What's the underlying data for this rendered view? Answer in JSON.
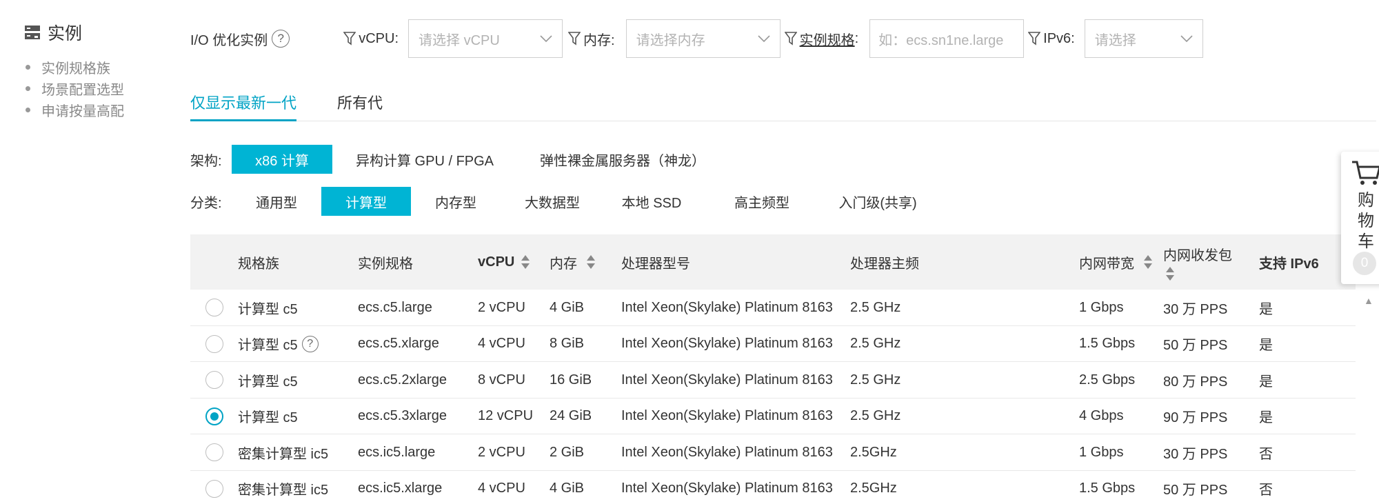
{
  "sidebar": {
    "title": "实例",
    "items": [
      {
        "label": "实例规格族"
      },
      {
        "label": "场景配置选型"
      },
      {
        "label": "申请按量高配"
      }
    ]
  },
  "filters": {
    "io_label": "I/O 优化实例",
    "vcpu_label": "vCPU:",
    "vcpu_placeholder": "请选择 vCPU",
    "memory_label": "内存:",
    "memory_placeholder": "请选择内存",
    "spec_label": "实例规格",
    "spec_colon": ":",
    "spec_placeholder": "如：ecs.sn1ne.large",
    "ipv6_label": "IPv6:",
    "ipv6_placeholder": "请选择"
  },
  "tabs": [
    {
      "label": "仅显示最新一代",
      "active": true
    },
    {
      "label": "所有代",
      "active": false
    }
  ],
  "architecture": {
    "label": "架构:",
    "options": [
      {
        "label": "x86 计算",
        "selected": true
      },
      {
        "label": "异构计算 GPU / FPGA",
        "selected": false
      },
      {
        "label": "弹性裸金属服务器（神龙）",
        "selected": false
      }
    ]
  },
  "category": {
    "label": "分类:",
    "options": [
      {
        "label": "通用型",
        "selected": false
      },
      {
        "label": "计算型",
        "selected": true
      },
      {
        "label": "内存型",
        "selected": false
      },
      {
        "label": "大数据型",
        "selected": false
      },
      {
        "label": "本地 SSD",
        "selected": false
      },
      {
        "label": "高主频型",
        "selected": false
      },
      {
        "label": "入门级(共享)",
        "selected": false
      }
    ]
  },
  "table": {
    "columns": {
      "family": "规格族",
      "spec": "实例规格",
      "vcpu": "vCPU",
      "memory": "内存",
      "processor": "处理器型号",
      "frequency": "处理器主频",
      "bandwidth": "内网带宽",
      "pps": "内网收发包",
      "ipv6": "支持 IPv6"
    },
    "rows": [
      {
        "family": "计算型 c5",
        "spec": "ecs.c5.large",
        "vcpu": "2 vCPU",
        "memory": "4 GiB",
        "processor": "Intel Xeon(Skylake) Platinum 8163",
        "frequency": "2.5 GHz",
        "bandwidth": "1 Gbps",
        "pps": "30 万 PPS",
        "ipv6": "是",
        "selected": false,
        "help": false
      },
      {
        "family": "计算型 c5",
        "spec": "ecs.c5.xlarge",
        "vcpu": "4 vCPU",
        "memory": "8 GiB",
        "processor": "Intel Xeon(Skylake) Platinum 8163",
        "frequency": "2.5 GHz",
        "bandwidth": "1.5 Gbps",
        "pps": "50 万 PPS",
        "ipv6": "是",
        "selected": false,
        "help": true
      },
      {
        "family": "计算型 c5",
        "spec": "ecs.c5.2xlarge",
        "vcpu": "8 vCPU",
        "memory": "16 GiB",
        "processor": "Intel Xeon(Skylake) Platinum 8163",
        "frequency": "2.5 GHz",
        "bandwidth": "2.5 Gbps",
        "pps": "80 万 PPS",
        "ipv6": "是",
        "selected": false,
        "help": false
      },
      {
        "family": "计算型 c5",
        "spec": "ecs.c5.3xlarge",
        "vcpu": "12 vCPU",
        "memory": "24 GiB",
        "processor": "Intel Xeon(Skylake) Platinum 8163",
        "frequency": "2.5 GHz",
        "bandwidth": "4 Gbps",
        "pps": "90 万 PPS",
        "ipv6": "是",
        "selected": true,
        "help": false
      },
      {
        "family": "密集计算型 ic5",
        "spec": "ecs.ic5.large",
        "vcpu": "2 vCPU",
        "memory": "2 GiB",
        "processor": "Intel Xeon(Skylake) Platinum 8163",
        "frequency": "2.5GHz",
        "bandwidth": "1 Gbps",
        "pps": "30 万 PPS",
        "ipv6": "否",
        "selected": false,
        "help": false
      },
      {
        "family": "密集计算型 ic5",
        "spec": "ecs.ic5.xlarge",
        "vcpu": "4 vCPU",
        "memory": "4 GiB",
        "processor": "Intel Xeon(Skylake) Platinum 8163",
        "frequency": "2.5GHz",
        "bandwidth": "1.5 Gbps",
        "pps": "50 万 PPS",
        "ipv6": "否",
        "selected": false,
        "help": false
      }
    ]
  },
  "cart": {
    "label_1": "购",
    "label_2": "物",
    "label_3": "车",
    "count": "0"
  },
  "help_mark": "?",
  "colors": {
    "accent": "#00a3c5",
    "chip_active": "#00b4d4",
    "border": "#cfcfcf",
    "placeholder": "#b3b3b3"
  }
}
